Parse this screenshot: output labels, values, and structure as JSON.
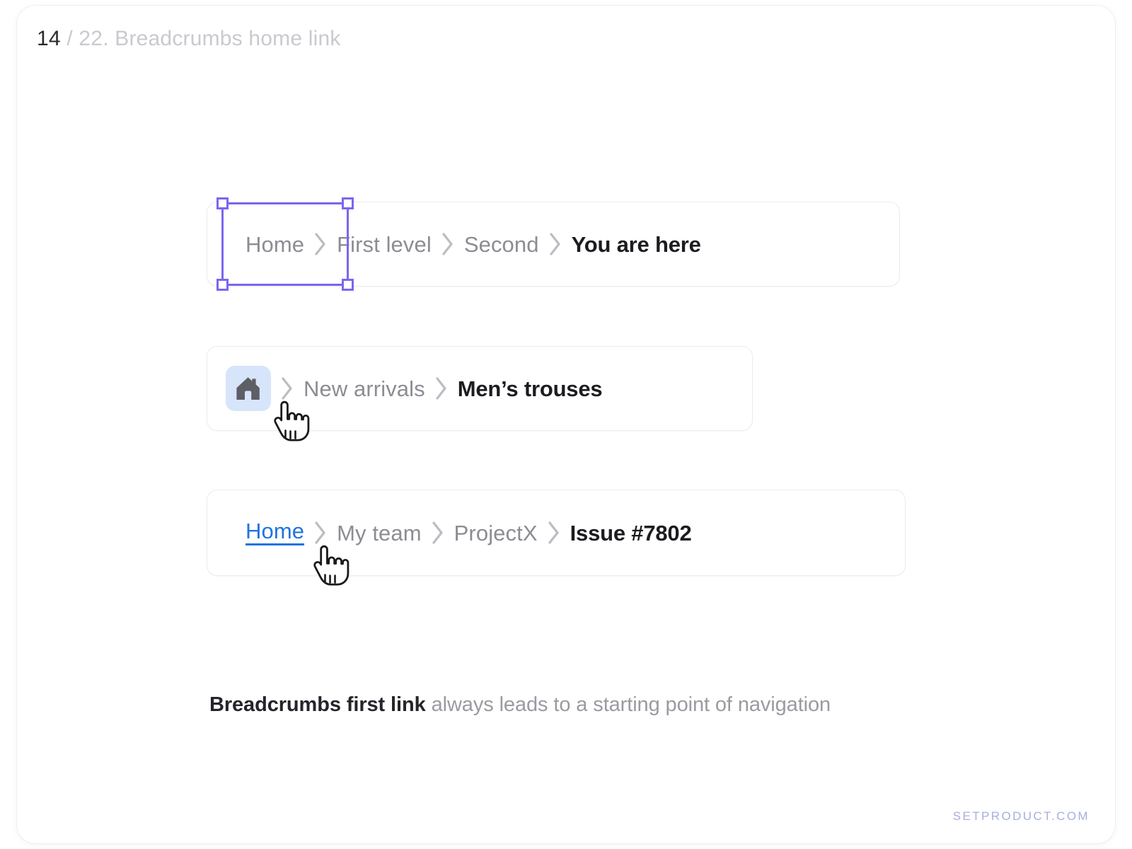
{
  "header": {
    "slide_number": "14",
    "separator": "/",
    "title": "22. Breadcrumbs home link"
  },
  "breadcrumbs": [
    {
      "id": "plain-text-breadcrumb",
      "selected_item_index": 0,
      "items": [
        {
          "label": "Home",
          "style": "muted",
          "icon": null
        },
        {
          "label": "First level",
          "style": "muted",
          "icon": null
        },
        {
          "label": "Second",
          "style": "muted",
          "icon": null
        },
        {
          "label": "You are here",
          "style": "current",
          "icon": null
        }
      ]
    },
    {
      "id": "home-icon-breadcrumb",
      "selected_item_index": null,
      "items": [
        {
          "label": "",
          "style": "icon-chip",
          "icon": "home-icon"
        },
        {
          "label": "New arrivals",
          "style": "muted",
          "icon": null
        },
        {
          "label": "Men’s trouses",
          "style": "current",
          "icon": null
        }
      ]
    },
    {
      "id": "home-link-breadcrumb",
      "selected_item_index": null,
      "items": [
        {
          "label": "Home",
          "style": "link-blue",
          "icon": null
        },
        {
          "label": "My team",
          "style": "muted",
          "icon": null
        },
        {
          "label": "ProjectX",
          "style": "muted",
          "icon": null
        },
        {
          "label": "Issue #7802",
          "style": "current",
          "icon": null
        }
      ]
    }
  ],
  "separator_icon": "chevron-right-icon",
  "cursors": [
    {
      "name": "pointer-hand-cursor-on-home-icon",
      "target": "home-icon-breadcrumb"
    },
    {
      "name": "pointer-hand-cursor-on-home-link",
      "target": "home-link-breadcrumb"
    }
  ],
  "caption": {
    "strong": "Breadcrumbs first link",
    "muted": " always leads to a starting point of navigation"
  },
  "watermark": {
    "label": "SETPRODUCT.COM"
  },
  "colors": {
    "page_background": "#ffffff",
    "muted_text": "#8c8c93",
    "current_text": "#1c1c20",
    "link_blue": "#2273e0",
    "home_chip_background": "#d7e5fb",
    "home_icon_fill": "#5e5e66",
    "selection_purple": "#7b67ee",
    "bar_border": "#ececee",
    "watermark": "#a8adde",
    "header_muted": "#c9c9ce"
  }
}
